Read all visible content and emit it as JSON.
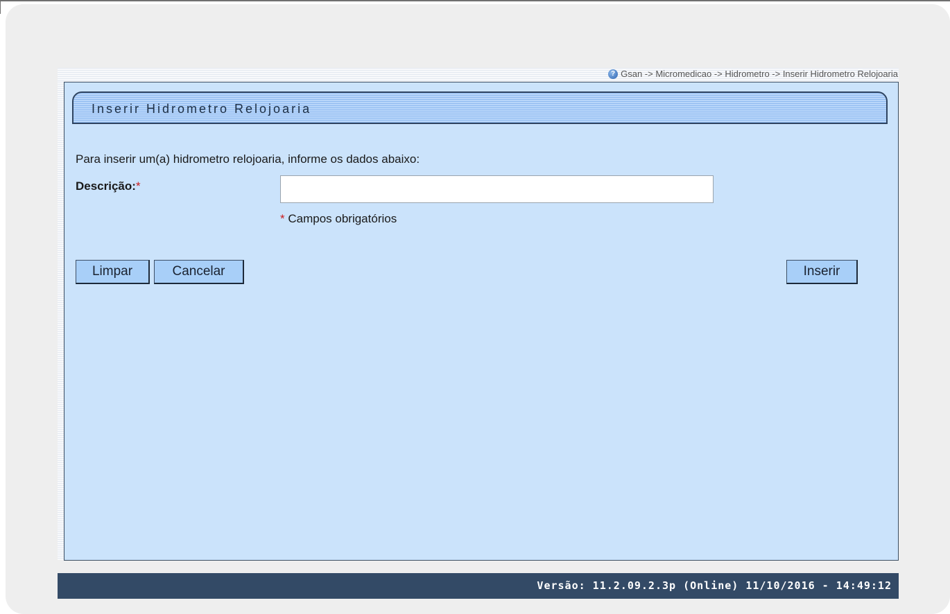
{
  "breadcrumb": "Gsan -> Micromedicao -> Hidrometro -> Inserir Hidrometro Relojoaria",
  "page_title": "Inserir Hidrometro Relojoaria",
  "intro_text": "Para inserir um(a) hidrometro relojoaria, informe os dados abaixo:",
  "form": {
    "descricao_label": "Descrição:",
    "required_marker": "*",
    "descricao_value": "",
    "required_note": "Campos obrigatórios"
  },
  "buttons": {
    "limpar": "Limpar",
    "cancelar": "Cancelar",
    "inserir": "Inserir"
  },
  "footer": {
    "version_text": "Versão: 11.2.09.2.3p (Online) 11/10/2016 - 14:49:12"
  },
  "icons": {
    "help": "help-icon"
  },
  "colors": {
    "panel_bg": "#cbe3fb",
    "button_bg": "#a8cff8",
    "footer_bg": "#334a66",
    "required": "#cc1b1b"
  }
}
